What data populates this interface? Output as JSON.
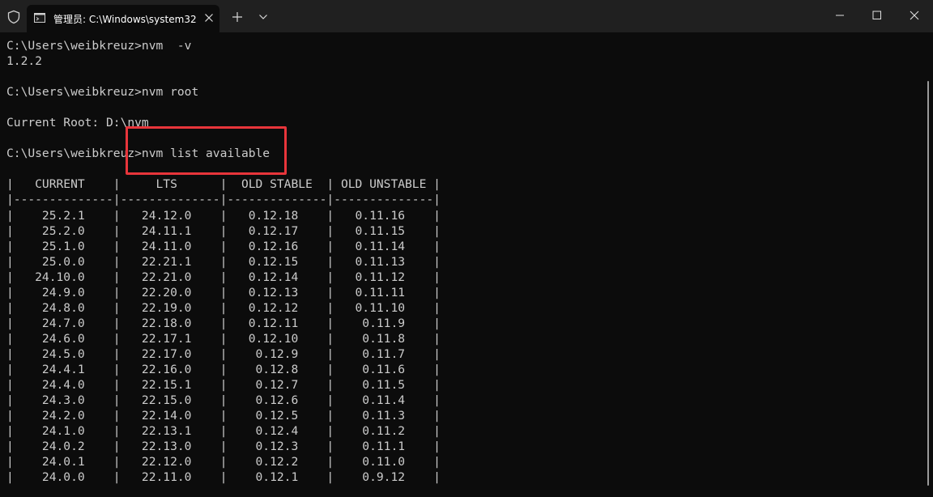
{
  "window": {
    "tab_title": "管理员: C:\\Windows\\system32"
  },
  "terminal": {
    "lines": [
      "C:\\Users\\weibkreuz>nvm  -v",
      "1.2.2",
      "",
      "C:\\Users\\weibkreuz>nvm root",
      "",
      "Current Root: D:\\nvm",
      "",
      "C:\\Users\\weibkreuz>nvm list available",
      "",
      "|   CURRENT    |     LTS      |  OLD STABLE  | OLD UNSTABLE |",
      "|--------------|--------------|--------------|--------------|",
      "|    25.2.1    |   24.12.0    |   0.12.18    |   0.11.16    |",
      "|    25.2.0    |   24.11.1    |   0.12.17    |   0.11.15    |",
      "|    25.1.0    |   24.11.0    |   0.12.16    |   0.11.14    |",
      "|    25.0.0    |   22.21.1    |   0.12.15    |   0.11.13    |",
      "|   24.10.0    |   22.21.0    |   0.12.14    |   0.11.12    |",
      "|    24.9.0    |   22.20.0    |   0.12.13    |   0.11.11    |",
      "|    24.8.0    |   22.19.0    |   0.12.12    |   0.11.10    |",
      "|    24.7.0    |   22.18.0    |   0.12.11    |    0.11.9    |",
      "|    24.6.0    |   22.17.1    |   0.12.10    |    0.11.8    |",
      "|    24.5.0    |   22.17.0    |    0.12.9    |    0.11.7    |",
      "|    24.4.1    |   22.16.0    |    0.12.8    |    0.11.6    |",
      "|    24.4.0    |   22.15.1    |    0.12.7    |    0.11.5    |",
      "|    24.3.0    |   22.15.0    |    0.12.6    |    0.11.4    |",
      "|    24.2.0    |   22.14.0    |    0.12.5    |    0.11.3    |",
      "|    24.1.0    |   22.13.1    |    0.12.4    |    0.11.2    |",
      "|    24.0.2    |   22.13.0    |    0.12.3    |    0.11.1    |",
      "|    24.0.1    |   22.12.0    |    0.12.2    |    0.11.0    |",
      "|    24.0.0    |   22.11.0    |    0.12.1    |    0.9.12    |"
    ]
  },
  "annotation": {
    "box_color": "#e8353b"
  },
  "colors": {
    "terminal_bg": "#0c0c0c",
    "terminal_fg": "#cccccc",
    "titlebar_bg": "#202020"
  }
}
